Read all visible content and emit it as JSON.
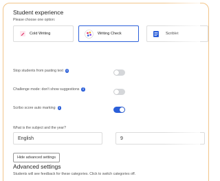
{
  "section": {
    "title": "Student experience",
    "prompt": "Please choose one option:"
  },
  "options": [
    {
      "label": "Cold Writing",
      "icon": "pencil-icon",
      "color": "#e0245e"
    },
    {
      "label": "Writing Check",
      "icon": "palette-icon",
      "color": "#2b5fd9"
    },
    {
      "label": "Scriblet",
      "icon": "document-icon",
      "color": "#2b5fd9"
    }
  ],
  "selected_option": "Writing Check",
  "settings": [
    {
      "label": "Stop students from pasting text",
      "enabled": false
    },
    {
      "label": "Challenge mode: don't show suggestions",
      "enabled": false
    },
    {
      "label": "Scribo score auto marking",
      "enabled": true
    }
  ],
  "subject_question": "What is the subject and the year?",
  "subject_value": "English",
  "year_value": "9",
  "hide_advanced_label": "Hide advanced settings",
  "advanced": {
    "title": "Advanced settings",
    "description": "Students will see feedback for these categories. Click to switch categories off."
  },
  "accent_color": "#2b5fd9",
  "border_accent": "#f2c489"
}
